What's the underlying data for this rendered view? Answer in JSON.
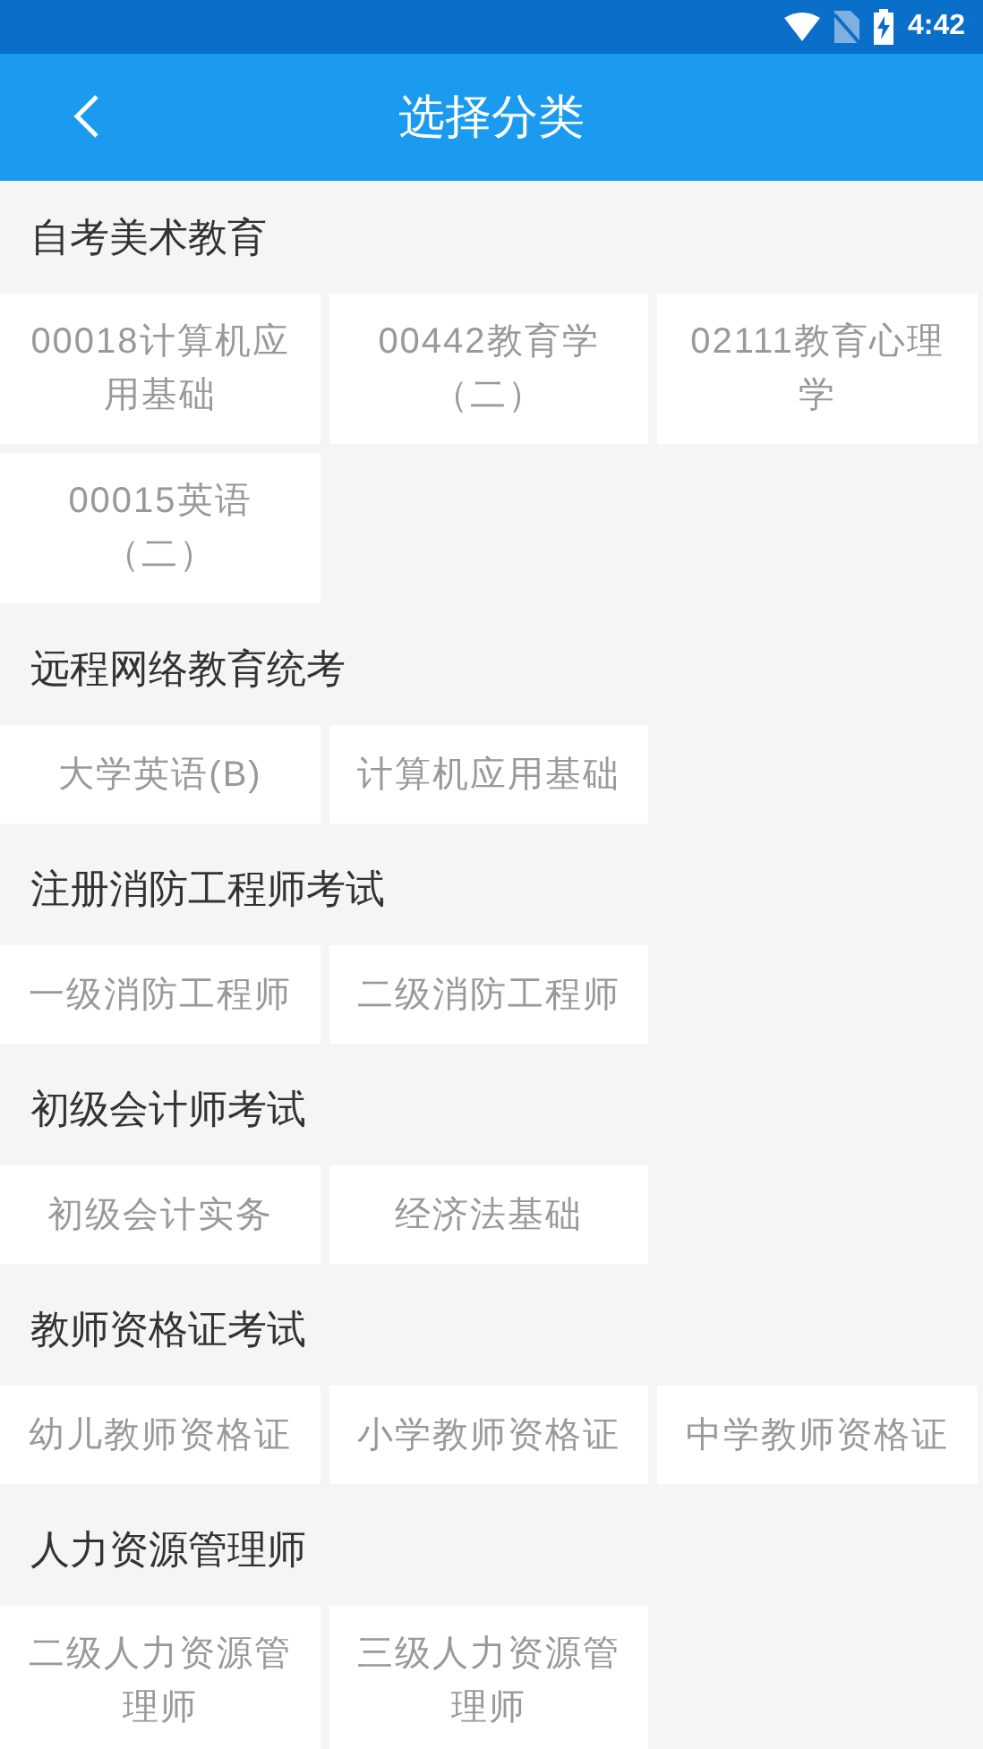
{
  "status_bar": {
    "time": "4:42"
  },
  "header": {
    "title": "选择分类"
  },
  "sections": [
    {
      "title": "自考美术教育",
      "items": [
        "00018计算机应用基础",
        "00442教育学（二）",
        "02111教育心理学",
        "00015英语（二）"
      ]
    },
    {
      "title": "远程网络教育统考",
      "items": [
        "大学英语(B)",
        "计算机应用基础"
      ]
    },
    {
      "title": "注册消防工程师考试",
      "items": [
        "一级消防工程师",
        "二级消防工程师"
      ]
    },
    {
      "title": "初级会计师考试",
      "items": [
        "初级会计实务",
        "经济法基础"
      ]
    },
    {
      "title": "教师资格证考试",
      "items": [
        "幼儿教师资格证",
        "小学教师资格证",
        "中学教师资格证"
      ]
    },
    {
      "title": "人力资源管理师",
      "items": [
        "二级人力资源管理师",
        "三级人力资源管理师"
      ]
    }
  ]
}
